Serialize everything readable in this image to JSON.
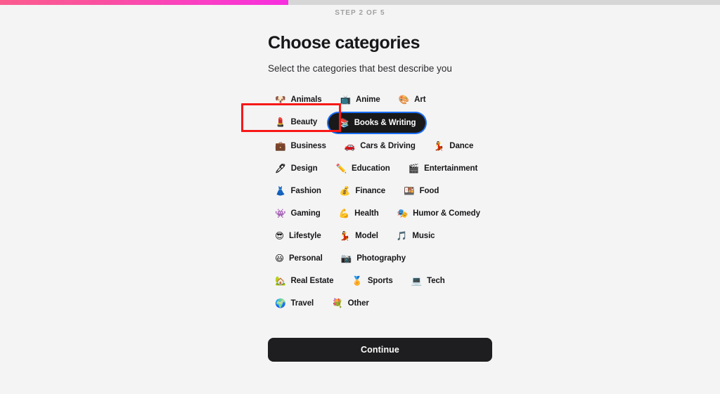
{
  "progress": {
    "step_label": "STEP 2 OF 5",
    "current_step": 2,
    "total_steps": 5,
    "percent": 40,
    "fill_color_start": "#fb5c8e",
    "fill_color_end": "#f72ee0",
    "track_color": "#d6d6d6"
  },
  "header": {
    "title": "Choose categories",
    "subtitle": "Select the categories that best describe you"
  },
  "categories": [
    {
      "label": "Animals",
      "emoji": "🐶",
      "icon_name": "dog-face-icon",
      "selected": false
    },
    {
      "label": "Anime",
      "emoji": "📺",
      "icon_name": "television-icon",
      "selected": false
    },
    {
      "label": "Art",
      "emoji": "🎨",
      "icon_name": "artist-palette-icon",
      "selected": false
    },
    {
      "label": "Beauty",
      "emoji": "💄",
      "icon_name": "lipstick-icon",
      "selected": false
    },
    {
      "label": "Books & Writing",
      "emoji": "📚",
      "icon_name": "books-icon",
      "selected": true
    },
    {
      "label": "Business",
      "emoji": "💼",
      "icon_name": "briefcase-icon",
      "selected": false
    },
    {
      "label": "Cars & Driving",
      "emoji": "🚗",
      "icon_name": "car-icon",
      "selected": false
    },
    {
      "label": "Dance",
      "emoji": "💃",
      "icon_name": "dancer-icon",
      "selected": false
    },
    {
      "label": "Design",
      "emoji": "🖊",
      "icon_name": "pen-icon",
      "selected": false
    },
    {
      "label": "Education",
      "emoji": "✏️",
      "icon_name": "pencil-icon",
      "selected": false
    },
    {
      "label": "Entertainment",
      "emoji": "🎬",
      "icon_name": "clapper-board-icon",
      "selected": false
    },
    {
      "label": "Fashion",
      "emoji": "👗",
      "icon_name": "dress-icon",
      "selected": false
    },
    {
      "label": "Finance",
      "emoji": "💰",
      "icon_name": "money-bag-icon",
      "selected": false
    },
    {
      "label": "Food",
      "emoji": "🍱",
      "icon_name": "bento-box-icon",
      "selected": false
    },
    {
      "label": "Gaming",
      "emoji": "👾",
      "icon_name": "alien-monster-icon",
      "selected": false
    },
    {
      "label": "Health",
      "emoji": "💪",
      "icon_name": "flexed-biceps-icon",
      "selected": false
    },
    {
      "label": "Humor & Comedy",
      "emoji": "🎭",
      "icon_name": "performing-arts-icon",
      "selected": false
    },
    {
      "label": "Lifestyle",
      "emoji": "😎",
      "icon_name": "smiling-face-sunglasses-icon",
      "selected": false
    },
    {
      "label": "Model",
      "emoji": "💃",
      "icon_name": "model-pose-icon",
      "selected": false
    },
    {
      "label": "Music",
      "emoji": "🎵",
      "icon_name": "musical-note-icon",
      "selected": false
    },
    {
      "label": "Personal",
      "emoji": "😃",
      "icon_name": "smiling-face-icon",
      "selected": false
    },
    {
      "label": "Photography",
      "emoji": "📷",
      "icon_name": "camera-icon",
      "selected": false
    },
    {
      "label": "Real Estate",
      "emoji": "🏡",
      "icon_name": "house-with-garden-icon",
      "selected": false
    },
    {
      "label": "Sports",
      "emoji": "🏅",
      "icon_name": "sports-medal-icon",
      "selected": false
    },
    {
      "label": "Tech",
      "emoji": "💻",
      "icon_name": "laptop-icon",
      "selected": false
    },
    {
      "label": "Travel",
      "emoji": "🌍",
      "icon_name": "globe-icon",
      "selected": false
    },
    {
      "label": "Other",
      "emoji": "💐",
      "icon_name": "bouquet-icon",
      "selected": false
    }
  ],
  "footer": {
    "continue_label": "Continue"
  },
  "annotation": {
    "target": "Books & Writing",
    "box_color": "#f81818"
  }
}
